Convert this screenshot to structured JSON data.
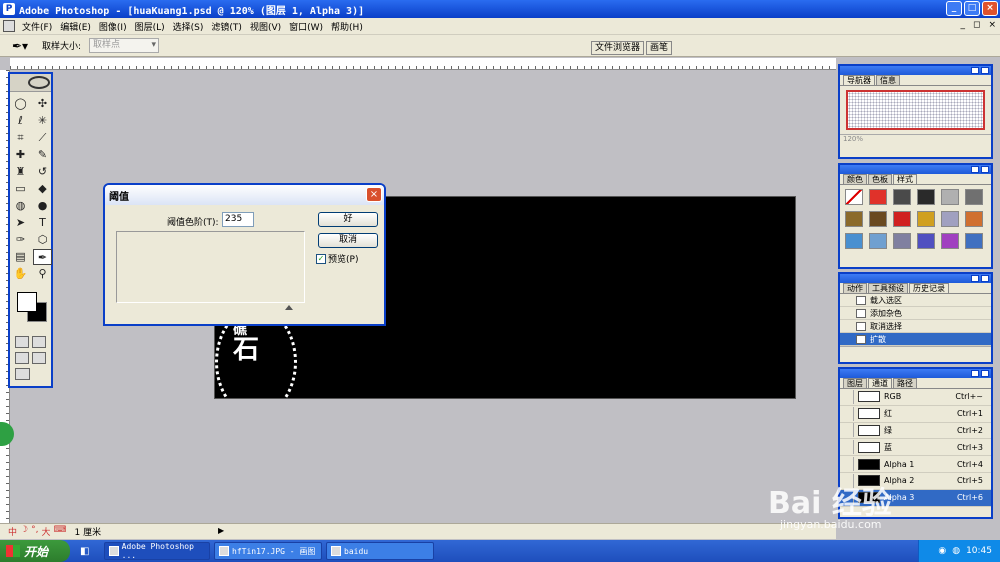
{
  "window": {
    "title": "Adobe Photoshop - [huaKuang1.psd @ 120% (图层 1, Alpha 3)]"
  },
  "menu": {
    "items": [
      "文件(F)",
      "编辑(E)",
      "图像(I)",
      "图层(L)",
      "选择(S)",
      "滤镜(T)",
      "视图(V)",
      "窗口(W)",
      "帮助(H)"
    ]
  },
  "options": {
    "sample_size_label": "取样大小:",
    "sample_size_value": "取样点",
    "palette_tabs": [
      "文件浏览器",
      "画笔"
    ]
  },
  "dialog": {
    "title": "阈值",
    "level_label": "阈值色阶(T):",
    "level_value": "235",
    "ok_label": "好",
    "cancel_label": "取消",
    "preview_label": "预览(P)",
    "preview_checked": true
  },
  "canvas": {
    "seal_top": "礁",
    "seal_char": "石"
  },
  "navigator": {
    "tabs": [
      "导航器",
      "信息"
    ],
    "zoom": "120%"
  },
  "color_panel": {
    "tabs": [
      "颜色",
      "色板",
      "样式"
    ],
    "swatch_colors": [
      "#ffffff",
      "#e0322a",
      "#4a4a4a",
      "#2a2a2a",
      "#b0b0b0",
      "#707070",
      "#8b6a2a",
      "#6a4a20",
      "#d02020",
      "#d0a020",
      "#a0a0c0",
      "#d07030",
      "#4a90d0",
      "#70a0d0",
      "#8080a0",
      "#5050c0",
      "#a040c0",
      "#4070c0"
    ]
  },
  "history_panel": {
    "tabs": [
      "动作",
      "工具预设",
      "历史记录"
    ],
    "items": [
      "载入选区",
      "添加杂色",
      "取消选择",
      "扩散"
    ],
    "active_index": 3
  },
  "channels_panel": {
    "tabs": [
      "图层",
      "通道",
      "路径"
    ],
    "rows": [
      {
        "name": "RGB",
        "shortcut": "Ctrl+~"
      },
      {
        "name": "红",
        "shortcut": "Ctrl+1"
      },
      {
        "name": "绿",
        "shortcut": "Ctrl+2"
      },
      {
        "name": "蓝",
        "shortcut": "Ctrl+3"
      },
      {
        "name": "Alpha 1",
        "shortcut": "Ctrl+4"
      },
      {
        "name": "Alpha 2",
        "shortcut": "Ctrl+5"
      },
      {
        "name": "Alpha 3",
        "shortcut": "Ctrl+6"
      }
    ]
  },
  "statusbar": {
    "ime": [
      "中",
      "°,",
      "大"
    ],
    "unit": "1 厘米"
  },
  "taskbar": {
    "start_label": "开始",
    "tasks": [
      "Adobe Photoshop ...",
      "hfTin17.JPG - 画图",
      "baidu"
    ],
    "clock": "10:45"
  },
  "watermark": {
    "text": "Bai 经验",
    "url": "jingyan.baidu.com"
  }
}
